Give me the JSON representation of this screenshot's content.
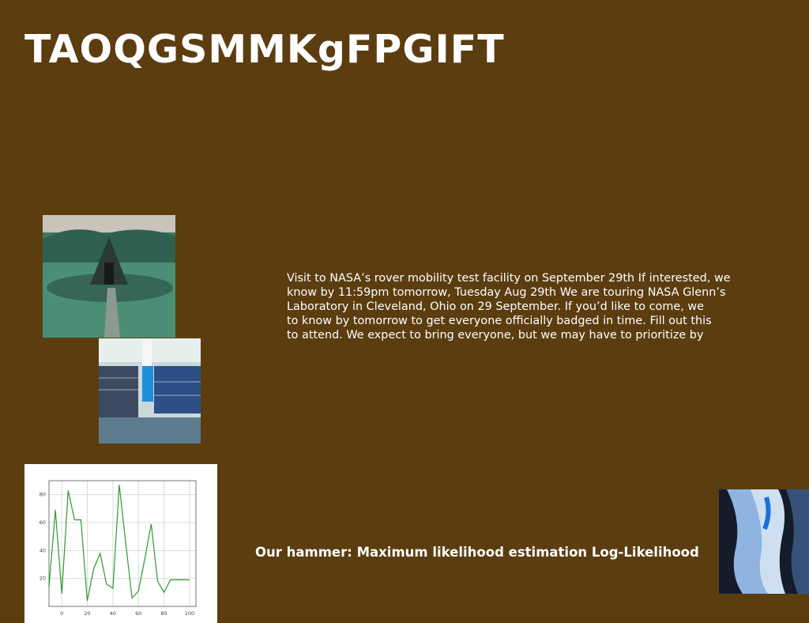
{
  "slide": {
    "title": "TAOQGSMMKgFPGIFT",
    "body_lines": [
      "Visit to NASA’s rover mobility test facility on September 29th If interested, we",
      "know by 11:59pm tomorrow, Tuesday Aug 29th We are touring NASA Glenn’s",
      "Laboratory in Cleveland, Ohio on 29 September. If you’d like to come, we",
      "to know by tomorrow to get everyone officially badged in time. Fill out this",
      "to attend. We expect to bring everyone, but we may have to prioritize by"
    ],
    "caption": "Our hammer: Maximum likelihood estimation Log-Likelihood",
    "background_color": "#5c3d10"
  },
  "images": {
    "house": "turf-house-photo",
    "library": "library-shelves-photo",
    "ice": "blue-ice-photo"
  },
  "chart_data": {
    "type": "line",
    "title": "",
    "xlabel": "",
    "ylabel": "",
    "xlim": [
      -10,
      105
    ],
    "ylim": [
      0,
      90
    ],
    "xticks": [
      "0",
      "20",
      "40",
      "60",
      "80",
      "100"
    ],
    "yticks": [
      "20",
      "40",
      "60",
      "80"
    ],
    "grid": true,
    "line_color": "#2e9a2e",
    "x": [
      -10,
      -5,
      0,
      5,
      10,
      15,
      20,
      25,
      30,
      35,
      40,
      45,
      50,
      55,
      60,
      65,
      70,
      75,
      80,
      85,
      90,
      95,
      100
    ],
    "values": [
      14,
      69,
      9,
      83,
      62,
      62,
      4,
      27,
      38,
      16,
      13,
      87,
      46,
      6,
      11,
      34,
      59,
      18,
      10,
      19,
      19,
      19,
      19
    ]
  }
}
